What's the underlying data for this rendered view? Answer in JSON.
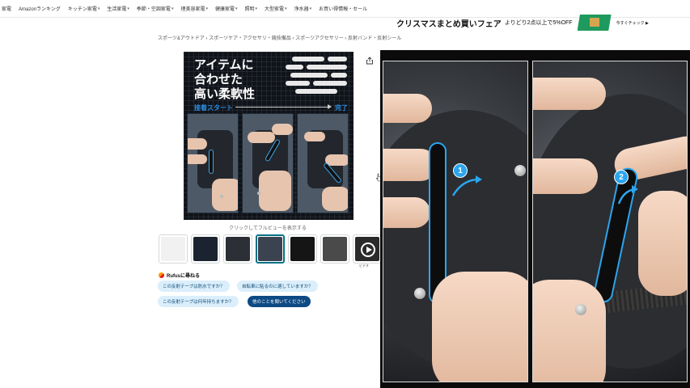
{
  "nav": {
    "items": [
      {
        "label": "家電",
        "caret": false
      },
      {
        "label": "Amazonランキング",
        "caret": false
      },
      {
        "label": "キッチン家電",
        "caret": true
      },
      {
        "label": "生活家電",
        "caret": true
      },
      {
        "label": "季節・空調家電",
        "caret": true
      },
      {
        "label": "理美容家電",
        "caret": true
      },
      {
        "label": "健康家電",
        "caret": true
      },
      {
        "label": "照明",
        "caret": true
      },
      {
        "label": "大型家電",
        "caret": true
      },
      {
        "label": "浄水器",
        "caret": true
      },
      {
        "label": "お買い得情報・セール",
        "caret": false
      }
    ]
  },
  "banner": {
    "title": "クリスマスまとめ買いフェア",
    "subtitle": "よりどり2点以上で5%OFF",
    "cta": "今すぐチェック ▶"
  },
  "breadcrumb": "スポーツ&アウトドア › スポーツケア・アクセサリ・競技備品 › スポーツアクセサリー › 反射バンド・反射シール",
  "product_image": {
    "headline_lines": [
      "アイテムに",
      "合わせた",
      "高い柔軟性"
    ],
    "step_start": "接着スタート",
    "step_end": "完了"
  },
  "click_hint": "クリックしてフルビューを表示する",
  "thumbnails": [
    {
      "name": "thumbnail-1",
      "bg": "#f1f1f1",
      "selected": false
    },
    {
      "name": "thumbnail-2",
      "bg": "#1b2330",
      "selected": false
    },
    {
      "name": "thumbnail-3",
      "bg": "#2c2f35",
      "selected": false
    },
    {
      "name": "thumbnail-4",
      "bg": "#3b4350",
      "selected": true
    },
    {
      "name": "thumbnail-5",
      "bg": "#151515",
      "selected": false
    },
    {
      "name": "thumbnail-6",
      "bg": "#4a4a4a",
      "selected": false
    },
    {
      "name": "thumbnail-video",
      "bg": "#2a2a2a",
      "selected": false
    }
  ],
  "video_label": "ビデオ",
  "rufus": {
    "title": "Rufusに尋ねる",
    "chips": [
      "この反射テープは防水ですか？",
      "自転車に貼るのに適していますか？",
      "この反射テープは何年持ちますか？",
      "他のことを聞いてください"
    ]
  },
  "video": {
    "frame1_badge": "1",
    "frame2_badge": "2",
    "accent": "#2ba5ee"
  },
  "colors": {
    "chip_bg": "#dbeefb",
    "chip_dark": "#0d4a85",
    "banner_green": "#1f9a5e"
  }
}
